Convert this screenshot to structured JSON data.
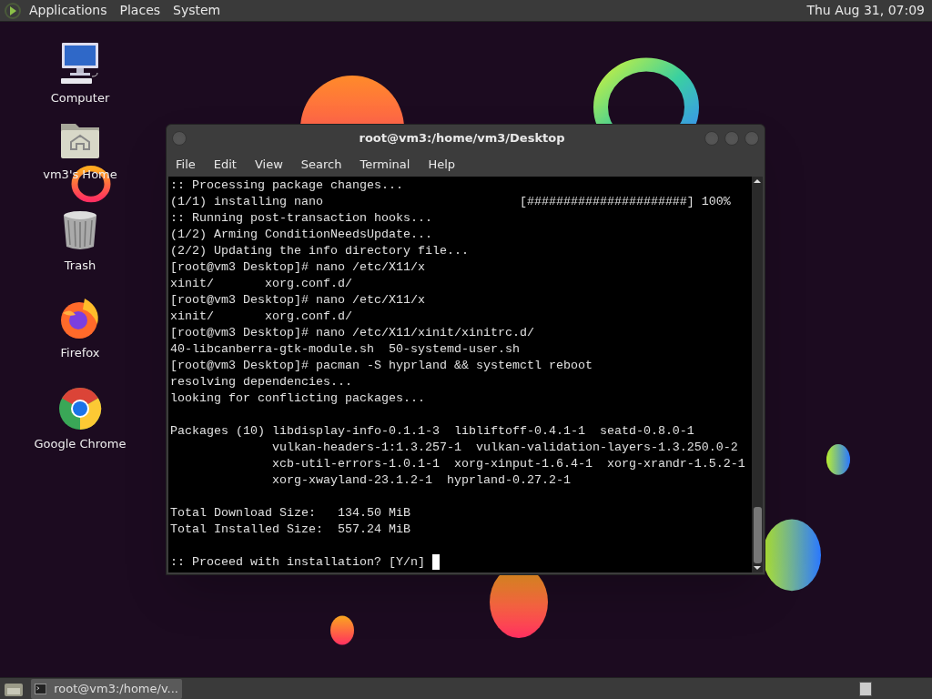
{
  "top_panel": {
    "menus": [
      "Applications",
      "Places",
      "System"
    ],
    "clock": "Thu Aug 31, 07:09"
  },
  "desktop_icons": [
    {
      "kind": "computer",
      "label": "Computer"
    },
    {
      "kind": "home",
      "label": "vm3's Home"
    },
    {
      "kind": "trash",
      "label": "Trash"
    },
    {
      "kind": "firefox",
      "label": "Firefox"
    },
    {
      "kind": "chrome",
      "label": "Google Chrome"
    }
  ],
  "terminal": {
    "title": "root@vm3:/home/vm3/Desktop",
    "menu": [
      "File",
      "Edit",
      "View",
      "Search",
      "Terminal",
      "Help"
    ],
    "lines": [
      {
        "kind": "text",
        "text": ":: Processing package changes..."
      },
      {
        "kind": "text",
        "text": "(1/1) installing nano                           [######################] 100%"
      },
      {
        "kind": "text",
        "text": ":: Running post-transaction hooks..."
      },
      {
        "kind": "text",
        "text": "(1/2) Arming ConditionNeedsUpdate..."
      },
      {
        "kind": "text",
        "text": "(2/2) Updating the info directory file..."
      },
      {
        "kind": "text",
        "text": "[root@vm3 Desktop]# nano /etc/X11/x"
      },
      {
        "kind": "text",
        "text": "xinit/       xorg.conf.d/"
      },
      {
        "kind": "text",
        "text": "[root@vm3 Desktop]# nano /etc/X11/x"
      },
      {
        "kind": "text",
        "text": "xinit/       xorg.conf.d/"
      },
      {
        "kind": "text",
        "text": "[root@vm3 Desktop]# nano /etc/X11/xinit/xinitrc.d/"
      },
      {
        "kind": "text",
        "text": "40-libcanberra-gtk-module.sh  50-systemd-user.sh"
      },
      {
        "kind": "text",
        "text": "[root@vm3 Desktop]# pacman -S hyprland && systemctl reboot"
      },
      {
        "kind": "text",
        "text": "resolving dependencies..."
      },
      {
        "kind": "text",
        "text": "looking for conflicting packages..."
      },
      {
        "kind": "blank"
      },
      {
        "kind": "text",
        "text": "Packages (10) libdisplay-info-0.1.1-3  libliftoff-0.4.1-1  seatd-0.8.0-1"
      },
      {
        "kind": "text",
        "text": "              vulkan-headers-1:1.3.257-1  vulkan-validation-layers-1.3.250.0-2"
      },
      {
        "kind": "text",
        "text": "              xcb-util-errors-1.0.1-1  xorg-xinput-1.6.4-1  xorg-xrandr-1.5.2-1"
      },
      {
        "kind": "text",
        "text": "              xorg-xwayland-23.1.2-1  hyprland-0.27.2-1"
      },
      {
        "kind": "blank"
      },
      {
        "kind": "text",
        "text": "Total Download Size:   134.50 MiB"
      },
      {
        "kind": "text",
        "text": "Total Installed Size:  557.24 MiB"
      },
      {
        "kind": "blank"
      },
      {
        "kind": "prompt",
        "text": ":: Proceed with installation? [Y/n] "
      }
    ]
  },
  "taskbar": {
    "tasks": [
      {
        "label": "root@vm3:/home/v...",
        "selected": true
      }
    ]
  }
}
